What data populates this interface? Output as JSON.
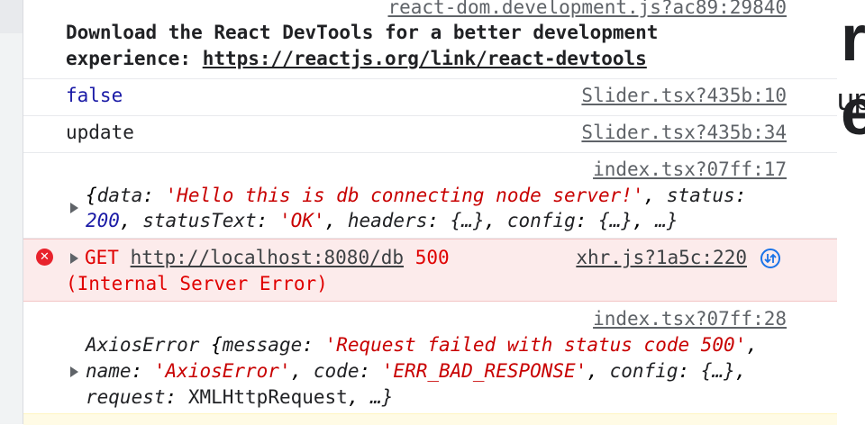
{
  "console": {
    "devtools_msg": {
      "source": "react-dom.development.js?ac89:29840",
      "text_line1": "Download the React DevTools for a better development",
      "text_line2_prefix": "experience: ",
      "link": "https://reactjs.org/link/react-devtools"
    },
    "msg_false": {
      "text": "false",
      "source": "Slider.tsx?435b:10"
    },
    "msg_update": {
      "text": "update",
      "source": "Slider.tsx?435b:34"
    },
    "msg_response": {
      "source": "index.tsx?07ff:17",
      "data_key": "data",
      "data_val": "'Hello this is db connecting node server!'",
      "status_key": "status",
      "status_val": "200",
      "statusText_key": "statusText",
      "statusText_val": "'OK'",
      "headers_key": "headers",
      "headers_val": "{…}",
      "config_key": "config",
      "config_val": "{…}",
      "ellipsis": "…}"
    },
    "msg_error": {
      "method": "GET",
      "url": "http://localhost:8080/db",
      "code": "500",
      "status_text": "(Internal Server Error)",
      "source": "xhr.js?1a5c:220",
      "icon": "x-circle-icon",
      "network_icon": "network-request-icon"
    },
    "msg_axios": {
      "source": "index.tsx?07ff:28",
      "class_name": "AxiosError",
      "message_key": "message",
      "message_val": "'Request failed with status code 500'",
      "name_key": "name",
      "name_val": "'AxiosError'",
      "code_key": "code",
      "code_val": "'ERR_BAD_RESPONSE'",
      "config_key": "config",
      "config_val": "{…}",
      "request_key": "request",
      "request_val": "XMLHttpRequest",
      "ellipsis": "…}"
    }
  },
  "page_behind": {
    "large_glyph": "r e",
    "sub_glyph": "up"
  },
  "colors": {
    "error_bg": "#fcebeb",
    "error_text": "#e00000",
    "string": "#c80000",
    "number": "#1a1aa6",
    "link_blue": "#1a73e8"
  }
}
